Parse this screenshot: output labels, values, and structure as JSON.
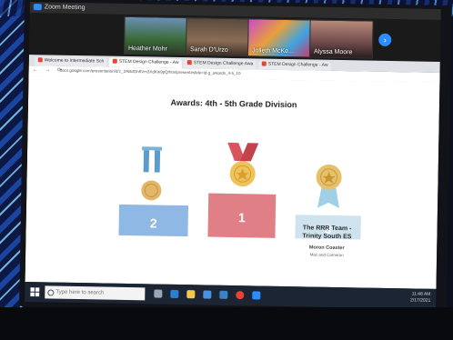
{
  "zoom": {
    "window_title": "Zoom Meeting",
    "participants": [
      {
        "name": "Heather Mohr"
      },
      {
        "name": "Sarah D'Urzo"
      },
      {
        "name": "Jolleth McKe..."
      },
      {
        "name": "Alyssa Moore"
      }
    ],
    "next_label": "›"
  },
  "browser": {
    "tabs": [
      {
        "label": "Welcome to Intermediate Sch"
      },
      {
        "label": "STEM Design Challenge - Aw"
      },
      {
        "label": "STEM Design Challenge Awa"
      },
      {
        "label": "STEM Design Challenge - Aw"
      }
    ],
    "nav_glyphs": "← → ⟳",
    "url": "docs.google.com/presentation/d/1_2ABdGh8Vm3XdKw9pQ/htmlpresent#slide=id.g_awards_4-5_10"
  },
  "slide": {
    "title": "Awards: 4th - 5th Grade Division",
    "podiums": [
      {
        "place": "2",
        "color": "#8fb8e4",
        "medal": "#e3b76a"
      },
      {
        "place": "1",
        "color": "#e07f86",
        "medal": "#f0c25a"
      },
      {
        "place": "3",
        "color": "#cfe3ef",
        "medal": "#e6c06a"
      }
    ],
    "winner_team": "The RRR Team -",
    "winner_school": "Trinity South ES",
    "winner_project": "Moron Coaster",
    "winner_author": "Max and Cameron"
  },
  "taskbar": {
    "search_placeholder": "Type here to search",
    "time": "11:48 AM",
    "date": "2/17/2021"
  },
  "colors": {
    "zoom_blue": "#2d8cff",
    "taskbar": "#1c2533"
  }
}
